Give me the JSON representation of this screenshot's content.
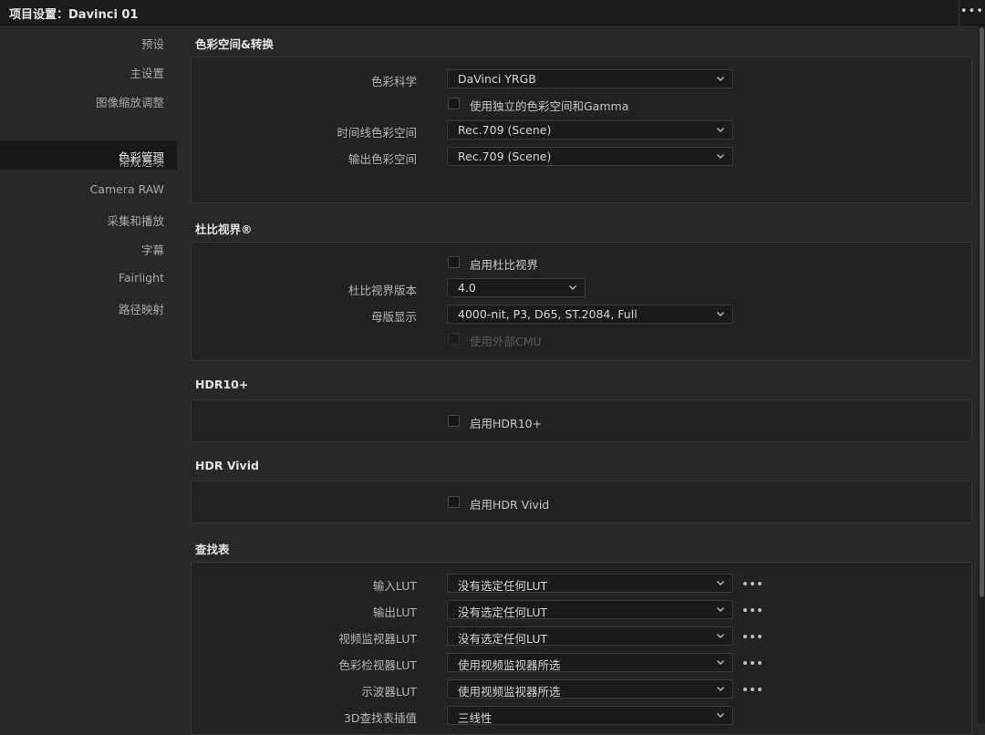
{
  "window": {
    "title": "项目设置：Davinci 01",
    "more_icon": "ellipsis-icon"
  },
  "sidebar": {
    "items": [
      {
        "label": "预设"
      },
      {
        "label": "主设置"
      },
      {
        "label": "图像缩放调整"
      },
      {
        "label": "色彩管理",
        "active": true
      },
      {
        "label": "常规选项"
      },
      {
        "label": "Camera RAW"
      },
      {
        "label": "采集和播放"
      },
      {
        "label": "字幕"
      },
      {
        "label": "Fairlight"
      },
      {
        "label": "路径映射"
      }
    ]
  },
  "color_space": {
    "title": "色彩空间&转换",
    "color_science_label": "色彩科学",
    "color_science_value": "DaVinci YRGB",
    "separate_gamma_label": "使用独立的色彩空间和Gamma",
    "timeline_label": "时间线色彩空间",
    "timeline_value": "Rec.709 (Scene)",
    "output_label": "输出色彩空间",
    "output_value": "Rec.709 (Scene)"
  },
  "dolby": {
    "title": "杜比视界®",
    "enable_label": "启用杜比视界",
    "version_label": "杜比视界版本",
    "version_value": "4.0",
    "mastering_label": "母版显示",
    "mastering_value": "4000-nit, P3, D65, ST.2084, Full",
    "cmu_label": "使用外部CMU"
  },
  "hdr10": {
    "title": "HDR10+",
    "enable_label": "启用HDR10+"
  },
  "hdr_vivid": {
    "title": "HDR Vivid",
    "enable_label": "启用HDR Vivid"
  },
  "lut": {
    "title": "查找表",
    "rows": [
      {
        "label": "输入LUT",
        "value": "没有选定任何LUT",
        "more": true
      },
      {
        "label": "输出LUT",
        "value": "没有选定任何LUT",
        "more": true
      },
      {
        "label": "视频监视器LUT",
        "value": "没有选定任何LUT",
        "more": true
      },
      {
        "label": "色彩检视器LUT",
        "value": "使用视频监视器所选",
        "more": true
      },
      {
        "label": "示波器LUT",
        "value": "使用视频监视器所选",
        "more": true
      },
      {
        "label": "3D查找表插值",
        "value": "三线性",
        "more": false
      }
    ]
  },
  "colors": {
    "bg": "#28282b",
    "panel": "#222224",
    "titlebar": "#1c1c1e",
    "active_nav": "#18181a"
  }
}
